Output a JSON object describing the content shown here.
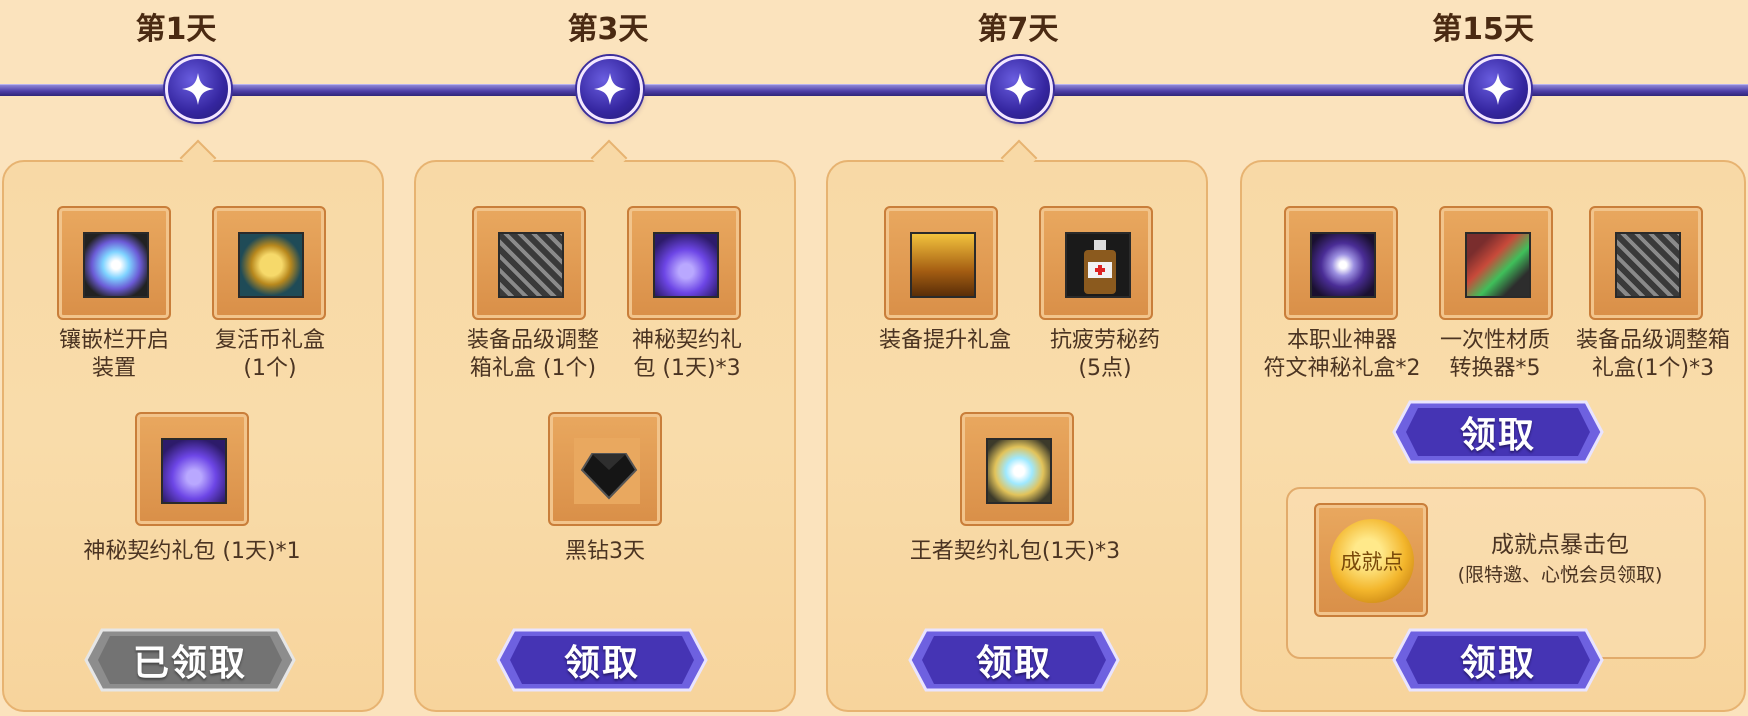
{
  "timeline": {
    "days": [
      {
        "label": "第1天"
      },
      {
        "label": "第3天"
      },
      {
        "label": "第7天"
      },
      {
        "label": "第15天"
      }
    ]
  },
  "cards": [
    {
      "items": [
        {
          "name": "镶嵌栏开启装置",
          "label_line1": "镶嵌栏开启",
          "label_line2": "装置",
          "icon": "socket-crystal-icon"
        },
        {
          "name": "复活币礼盒",
          "label_line1": "复活币礼盒",
          "label_line2": "(1个)",
          "icon": "revive-coin-icon"
        },
        {
          "name": "神秘契约礼包",
          "label_line1": "神秘契约礼包 (1天)*1",
          "icon": "purple-pouch-icon"
        }
      ],
      "button": {
        "label": "已领取",
        "state": "claimed"
      }
    },
    {
      "items": [
        {
          "name": "装备品级调整箱礼盒",
          "label_line1": "装备品级调整",
          "label_line2": "箱礼盒 (1个)",
          "icon": "gear-box-icon"
        },
        {
          "name": "神秘契约礼包",
          "label_line1": "神秘契约礼",
          "label_line2": "包 (1天)*3",
          "icon": "purple-pouch-icon"
        },
        {
          "name": "黑钻3天",
          "label_line1": "黑钻3天",
          "icon": "black-diamond-icon"
        }
      ],
      "button": {
        "label": "领取",
        "state": "available"
      }
    },
    {
      "items": [
        {
          "name": "装备提升礼盒",
          "label_line1": "装备提升礼盒",
          "icon": "treasure-chest-icon"
        },
        {
          "name": "抗疲劳秘药",
          "label_line1": "抗疲劳秘药",
          "label_line2": "(5点)",
          "icon": "potion-bottle-icon"
        },
        {
          "name": "王者契约礼包",
          "label_line1": "王者契约礼包(1天)*3",
          "icon": "king-contract-icon"
        }
      ],
      "button": {
        "label": "领取",
        "state": "available"
      }
    },
    {
      "items": [
        {
          "name": "本职业神器符文神秘礼盒",
          "label_line1": "本职业神器",
          "label_line2": "符文神秘礼盒*2",
          "icon": "rune-box-icon"
        },
        {
          "name": "一次性材质转换器",
          "label_line1": "一次性材质",
          "label_line2": "转换器*5",
          "icon": "material-converter-icon"
        },
        {
          "name": "装备品级调整箱礼盒",
          "label_line1": "装备品级调整箱",
          "label_line2": "礼盒(1个)*3",
          "icon": "gear-box-icon"
        }
      ],
      "button": {
        "label": "领取",
        "state": "available"
      },
      "bonus": {
        "coin_text": "成就点",
        "title": "成就点暴击包",
        "note": "(限特邀、心悦会员领取)",
        "button_label": "领取",
        "icon": "achievement-coin-icon"
      }
    }
  ],
  "colors": {
    "background": "#fbe3bd",
    "accent_purple": "#4e3fa8",
    "card_border": "#e7b371",
    "claimed_gray": "#8a8a8a"
  }
}
